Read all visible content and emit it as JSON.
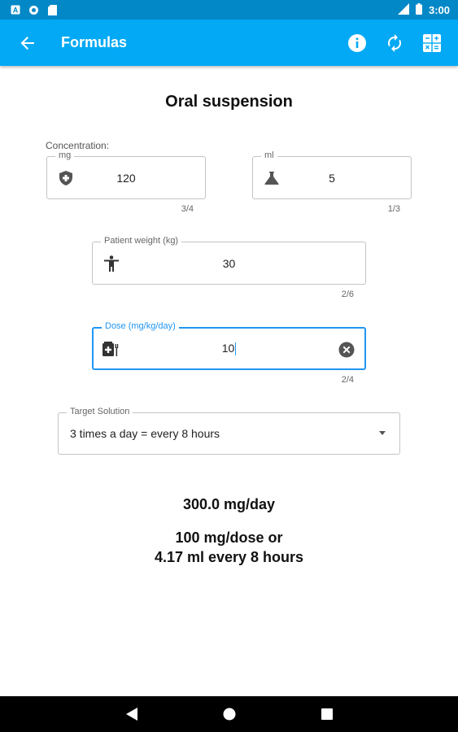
{
  "status_bar": {
    "time": "3:00",
    "icons": [
      "a-badge-icon",
      "circle-o-icon",
      "sd-card-icon",
      "signal-icon",
      "battery-icon"
    ]
  },
  "app_bar": {
    "title": "Formulas",
    "actions": [
      "info-icon",
      "refresh-icon",
      "calculator-icon"
    ]
  },
  "heading": "Oral suspension",
  "concentration": {
    "label": "Concentration:",
    "mg": {
      "label": "mg",
      "value": "120",
      "counter": "3/4",
      "icon": "shield-icon"
    },
    "ml": {
      "label": "ml",
      "value": "5",
      "counter": "1/3",
      "icon": "flask-icon"
    }
  },
  "patient_weight": {
    "label": "Patient weight (kg)",
    "value": "30",
    "counter": "2/6",
    "icon": "person-icon"
  },
  "dose": {
    "label": "Dose (mg/kg/day)",
    "value": "10",
    "counter": "2/4",
    "icon": "medicine-icon"
  },
  "target_solution": {
    "label": "Target Solution",
    "value": "3 times a day = every 8 hours"
  },
  "results": {
    "per_day": "300.0 mg/day",
    "per_dose": "100 mg/dose or",
    "volume": "4.17 ml every 8 hours"
  },
  "colors": {
    "primary": "#03a9f4",
    "primary_dark": "#0288c7",
    "focus": "#2196f3"
  }
}
